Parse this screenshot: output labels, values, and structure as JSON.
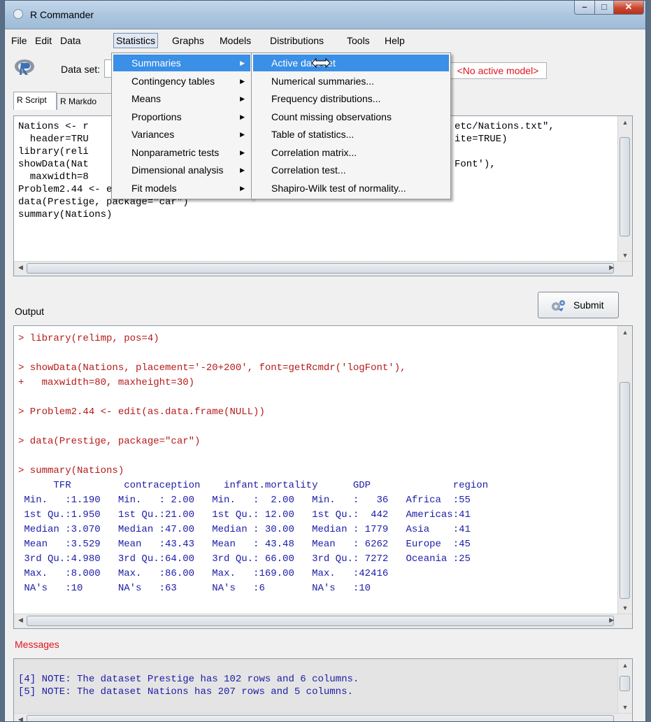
{
  "window": {
    "title": "R Commander"
  },
  "menubar": [
    "File",
    "Edit",
    "Data",
    "Statistics",
    "Graphs",
    "Models",
    "Distributions",
    "Tools",
    "Help"
  ],
  "toolbar": {
    "dataset_label": "Data set:",
    "model_button": "<No active model>"
  },
  "tabs": [
    "R Script",
    "R Markdo"
  ],
  "script_lines": [
    "Nations <- r",
    "  header=TRU",
    "library(reli",
    "showData(Nat",
    "  maxwidth=8",
    "Problem2.44 <- edit(as.data.frame(NULL))",
    "data(Prestige, package=\"car\")",
    "summary(Nations)"
  ],
  "script_right_fragments": [
    "etc/Nations.txt\",",
    "ite=TRUE)",
    "",
    "Font'),",
    ""
  ],
  "submit_label": "Submit",
  "output_label": "Output",
  "output_lines": [
    {
      "text": "> library(relimp, pos=4)",
      "color": "red"
    },
    {
      "text": "",
      "color": "red"
    },
    {
      "text": "> showData(Nations, placement='-20+200', font=getRcmdr('logFont'),",
      "color": "red"
    },
    {
      "text": "+   maxwidth=80, maxheight=30)",
      "color": "red"
    },
    {
      "text": "",
      "color": "red"
    },
    {
      "text": "> Problem2.44 <- edit(as.data.frame(NULL))",
      "color": "red"
    },
    {
      "text": "",
      "color": "red"
    },
    {
      "text": "> data(Prestige, package=\"car\")",
      "color": "red"
    },
    {
      "text": "",
      "color": "red"
    },
    {
      "text": "> summary(Nations)",
      "color": "red"
    },
    {
      "text": "      TFR         contraception    infant.mortality      GDP              region",
      "color": "blue"
    },
    {
      "text": " Min.   :1.190   Min.   : 2.00   Min.   :  2.00   Min.   :   36   Africa  :55",
      "color": "blue"
    },
    {
      "text": " 1st Qu.:1.950   1st Qu.:21.00   1st Qu.: 12.00   1st Qu.:  442   Americas:41",
      "color": "blue"
    },
    {
      "text": " Median :3.070   Median :47.00   Median : 30.00   Median : 1779   Asia    :41",
      "color": "blue"
    },
    {
      "text": " Mean   :3.529   Mean   :43.43   Mean   : 43.48   Mean   : 6262   Europe  :45",
      "color": "blue"
    },
    {
      "text": " 3rd Qu.:4.980   3rd Qu.:64.00   3rd Qu.: 66.00   3rd Qu.: 7272   Oceania :25",
      "color": "blue"
    },
    {
      "text": " Max.   :8.000   Max.   :86.00   Max.   :169.00   Max.   :42416",
      "color": "blue"
    },
    {
      "text": " NA's   :10      NA's   :63      NA's   :6        NA's   :10",
      "color": "blue"
    }
  ],
  "messages_label": "Messages",
  "message_lines": [
    "[4] NOTE: The dataset Prestige has 102 rows and 6 columns.",
    "[5] NOTE: The dataset Nations has 207 rows and 5 columns."
  ],
  "statistics_menu": [
    {
      "label": "Summaries",
      "submenu": true
    },
    {
      "label": "Contingency tables",
      "submenu": true
    },
    {
      "label": "Means",
      "submenu": true
    },
    {
      "label": "Proportions",
      "submenu": true
    },
    {
      "label": "Variances",
      "submenu": true
    },
    {
      "label": "Nonparametric tests",
      "submenu": true
    },
    {
      "label": "Dimensional analysis",
      "submenu": true
    },
    {
      "label": "Fit models",
      "submenu": true
    }
  ],
  "summaries_menu": [
    "Active data set",
    "Numerical summaries...",
    "Frequency distributions...",
    "Count missing observations",
    "Table of statistics...",
    "Correlation matrix...",
    "Correlation test...",
    "Shapiro-Wilk test of normality..."
  ],
  "highlighted": {
    "statistics_menu": 0,
    "summaries_menu": 0
  },
  "colors": {
    "highlight": "#3a8fe6",
    "output_command": "#b51a1a",
    "output_result": "#1c1ca8",
    "warning_text": "#e0141e"
  }
}
